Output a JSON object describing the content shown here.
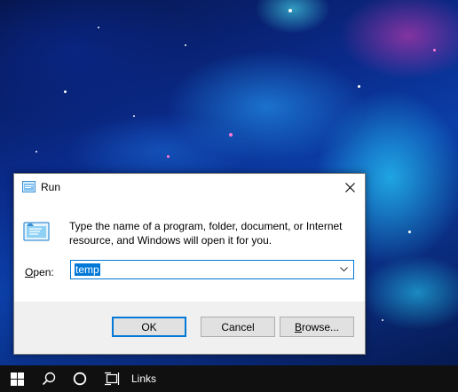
{
  "dialog": {
    "title": "Run",
    "description": "Type the name of a program, folder, document, or Internet resource, and Windows will open it for you.",
    "open_label_accel": "O",
    "open_label_rest": "pen:",
    "input_value": "temp",
    "ok_label": "OK",
    "cancel_label": "Cancel",
    "browse_label_accel": "B",
    "browse_label_rest": "rowse..."
  },
  "taskbar": {
    "links_label": "Links",
    "icons": [
      "windows-start-icon",
      "search-icon",
      "cortana-icon",
      "task-view-icon"
    ]
  },
  "colors": {
    "accent": "#0078d7",
    "taskbar": "#101010",
    "footer": "#f0f0f0"
  }
}
